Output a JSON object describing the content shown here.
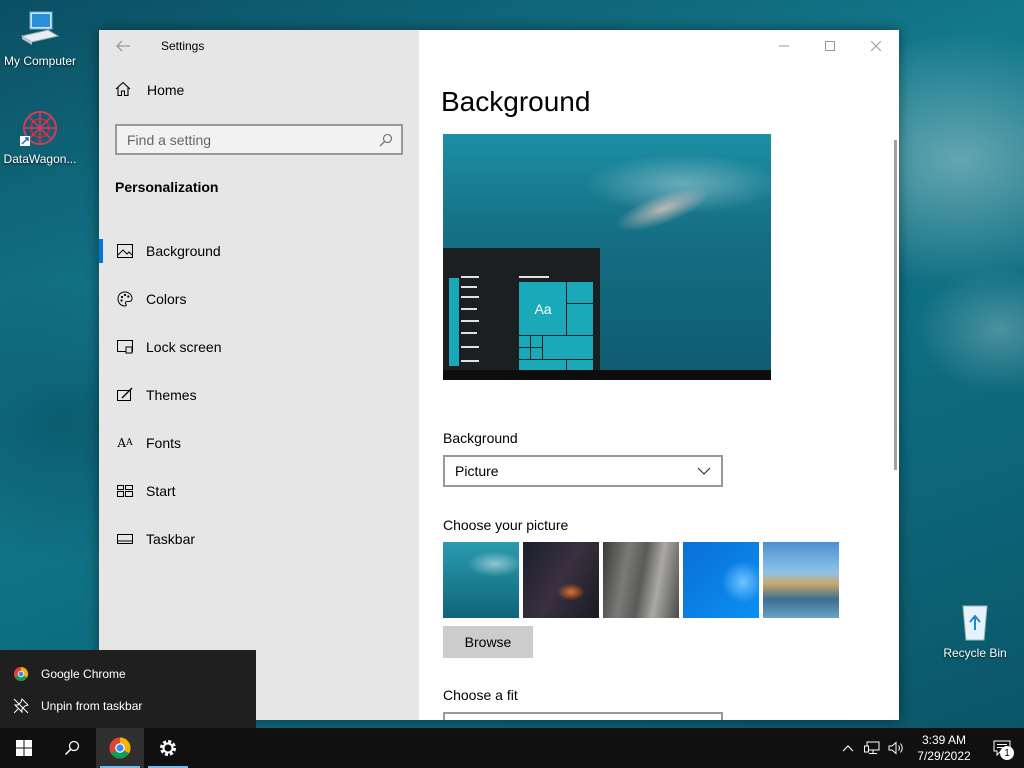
{
  "desktop": {
    "icons": [
      {
        "label": "My Computer",
        "icon": "computer-icon"
      },
      {
        "label": "DataWagon...",
        "icon": "datawagon-icon"
      },
      {
        "label": "Recycle Bin",
        "icon": "recycle-bin-icon"
      }
    ]
  },
  "settings": {
    "app_title": "Settings",
    "nav": {
      "home_label": "Home",
      "search_placeholder": "Find a setting",
      "section_title": "Personalization",
      "items": [
        {
          "label": "Background",
          "icon": "picture-icon",
          "active": true
        },
        {
          "label": "Colors",
          "icon": "palette-icon"
        },
        {
          "label": "Lock screen",
          "icon": "lock-screen-icon"
        },
        {
          "label": "Themes",
          "icon": "brush-icon"
        },
        {
          "label": "Fonts",
          "icon": "font-icon"
        },
        {
          "label": "Start",
          "icon": "start-layout-icon"
        },
        {
          "label": "Taskbar",
          "icon": "taskbar-icon"
        }
      ]
    },
    "content": {
      "page_title": "Background",
      "preview_tile_text": "Aa",
      "background_label": "Background",
      "background_value": "Picture",
      "choose_picture_label": "Choose your picture",
      "browse_label": "Browse",
      "choose_fit_label": "Choose a fit"
    }
  },
  "jumplist": {
    "items": [
      {
        "label": "Google Chrome",
        "icon": "chrome-icon"
      },
      {
        "label": "Unpin from taskbar",
        "icon": "unpin-icon"
      }
    ]
  },
  "taskbar": {
    "time": "3:39 AM",
    "date": "7/29/2022",
    "notification_count": "1"
  },
  "colors": {
    "accent": "#0078d7",
    "nav_bg": "#e6e6e6",
    "taskbar_bg": "#101010"
  }
}
